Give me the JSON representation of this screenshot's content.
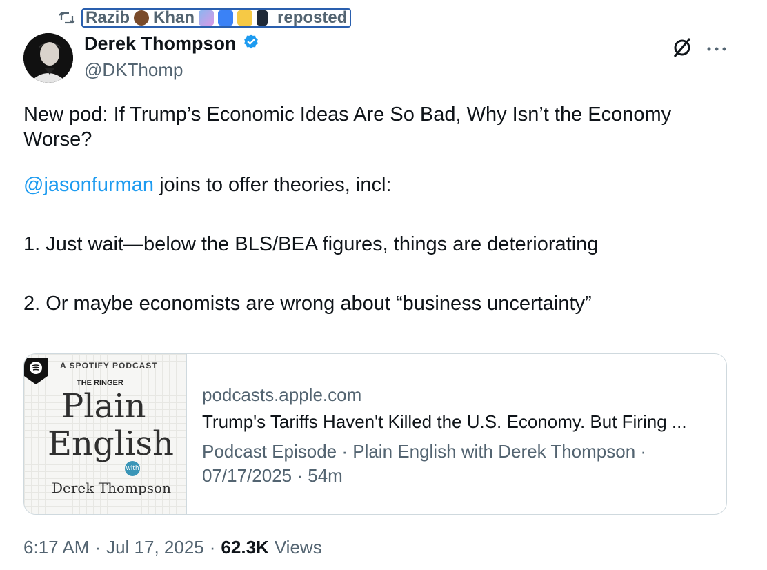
{
  "repost": {
    "reposter_name_part1": "Razib",
    "reposter_name_part2": "Khan",
    "suffix": "reposted"
  },
  "tweet": {
    "author_name": "Derek Thompson",
    "handle": "@DKThomp",
    "text": {
      "line1": "New pod: If Trump’s Economic Ideas Are So Bad, Why Isn’t the Economy Worse?",
      "mention": "@jasonfurman",
      "after_mention": " joins to offer theories, incl:",
      "point1": "1. Just wait—below the BLS/BEA figures, things are deteriorating",
      "point2": "2. Or maybe economists are wrong about “business uncertainty”"
    },
    "card": {
      "domain": "podcasts.apple.com",
      "title": "Trump's Tariffs Haven't Killed the U.S. Economy. But Firing ...",
      "description": "Podcast Episode · Plain English with Derek Thompson · 07/17/2025 · 54m",
      "thumb_label": "A SPOTIFY PODCAST",
      "thumb_ringer": "THE RINGER",
      "thumb_title1": "Plain",
      "thumb_title2": "English",
      "thumb_with": "with",
      "thumb_author": "Derek Thompson"
    },
    "meta": {
      "time": "6:17 AM",
      "date": "Jul 17, 2025",
      "views_count": "62.3K",
      "views_label": "Views"
    }
  },
  "icons": {
    "repost": "repost-icon",
    "verified": "verified-badge-icon",
    "grok": "grok-icon",
    "more": "more-icon"
  },
  "colors": {
    "link": "#1d9bf0",
    "secondary": "#536471",
    "verified": "#1d9bf0"
  }
}
